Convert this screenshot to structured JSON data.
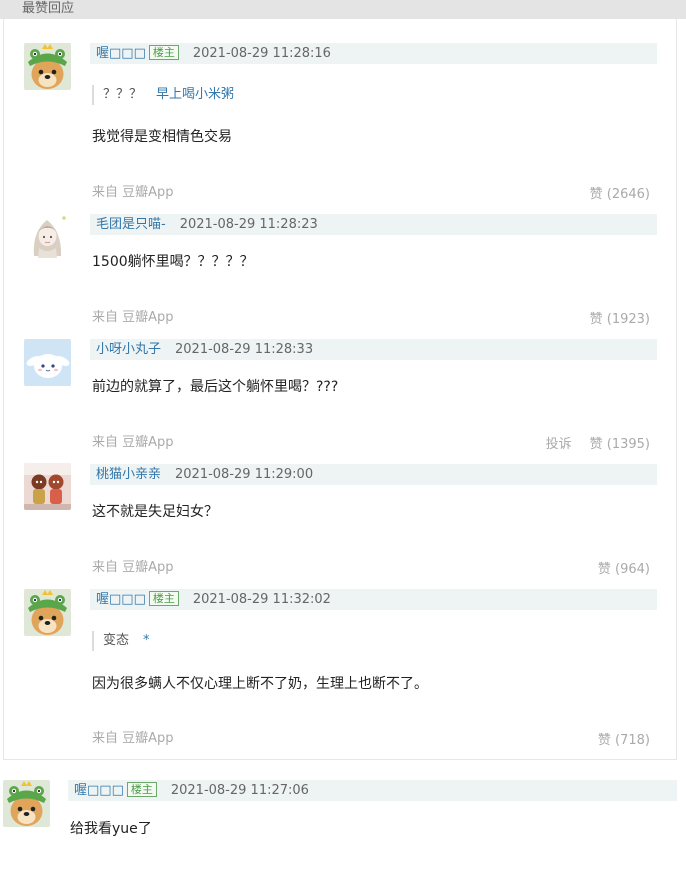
{
  "section": {
    "title": "最赞回应"
  },
  "comments": [
    {
      "username": "喔□□□",
      "badge": "楼主",
      "time": "2021-08-29 11:28:16",
      "quote": {
        "text": "？？？",
        "author": "早上喝小米粥"
      },
      "body": "我觉得是变相情色交易",
      "source": "来自 豆瓣App",
      "like_label": "赞 (2646)",
      "avatar": "dog-frog-hat-icon"
    },
    {
      "username": "毛团是只喵-",
      "time": "2021-08-29 11:28:23",
      "body": "1500躺怀里喝？？？？？",
      "source": "来自 豆瓣App",
      "like_label": "赞 (1923)",
      "avatar": "anime-girl-sketch-icon"
    },
    {
      "username": "小呀小丸子",
      "time": "2021-08-29 11:28:33",
      "body": "前边的就算了，最后这个躺怀里喝？???",
      "source": "来自 豆瓣App",
      "report_label": "投诉",
      "like_label": "赞 (1395)",
      "avatar": "cinnamoroll-icon"
    },
    {
      "username": "桃猫小亲亲",
      "time": "2021-08-29 11:29:00",
      "body": "这不就是失足妇女？",
      "source": "来自 豆瓣App",
      "like_label": "赞 (964)",
      "avatar": "toy-figures-icon"
    },
    {
      "username": "喔□□□",
      "badge": "楼主",
      "time": "2021-08-29 11:32:02",
      "quote": {
        "text": "变态",
        "author": "*"
      },
      "body": "因为很多螨人不仅心理上断不了奶，生理上也断不了。",
      "source": "来自 豆瓣App",
      "like_label": "赞 (718)",
      "avatar": "dog-frog-hat-icon"
    }
  ],
  "bottom_comment": {
    "username": "喔□□□",
    "badge": "楼主",
    "time": "2021-08-29 11:27:06",
    "body": "给我看yue了",
    "avatar": "dog-frog-hat-icon"
  },
  "colors": {
    "username": "#3377aa",
    "meta_bar_bg": "#eef3f3",
    "badge_green": "#4b9b4b",
    "muted": "#aaaaaa"
  }
}
